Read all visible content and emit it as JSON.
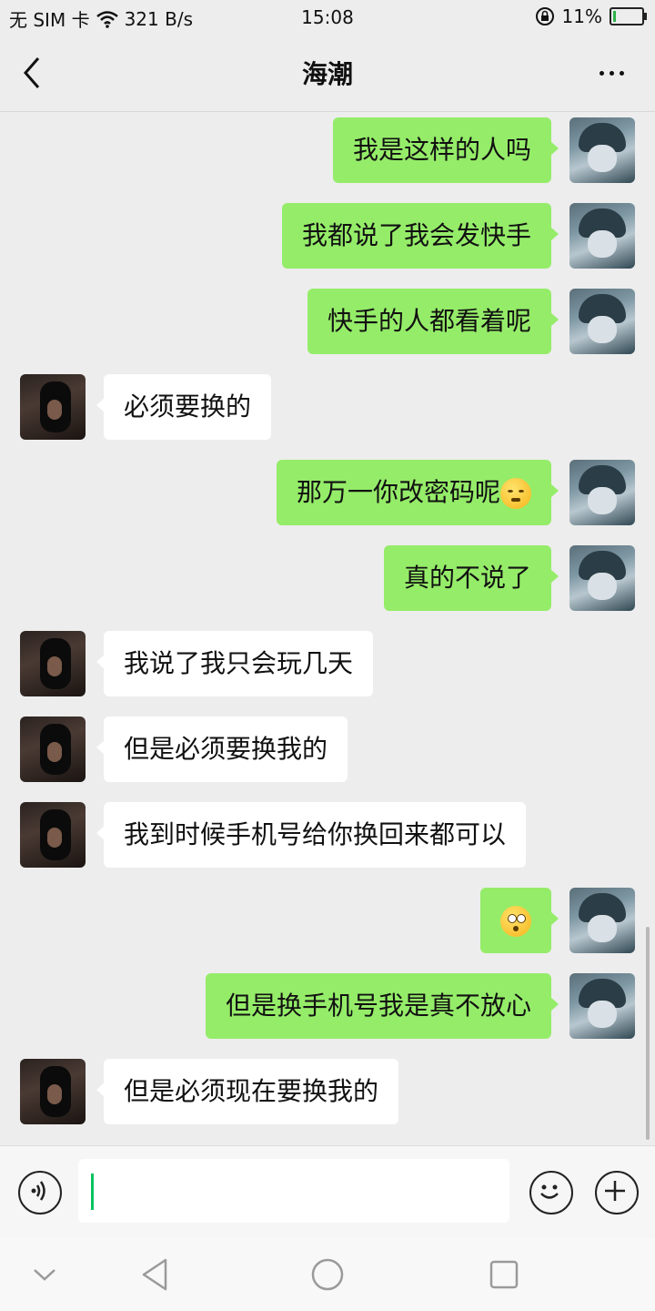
{
  "status_bar": {
    "carrier": "无 SIM 卡",
    "speed": "321 B/s",
    "time": "15:08",
    "battery_percent": "11%",
    "battery_level": 0.11,
    "icons": [
      "wifi-icon",
      "rotation-lock-icon",
      "battery-icon"
    ]
  },
  "header": {
    "title": "海潮",
    "back_icon": "back-arrow-icon",
    "more_icon": "more-dots-icon"
  },
  "messages": [
    {
      "side": "me",
      "text": "我是这样的人吗"
    },
    {
      "side": "me",
      "text": "我都说了我会发快手"
    },
    {
      "side": "me",
      "text": "快手的人都看着呢"
    },
    {
      "side": "them",
      "text": "必须要换的"
    },
    {
      "side": "me",
      "text": "那万一你改密码呢",
      "emoji": "squint-face-emoji"
    },
    {
      "side": "me",
      "text": "真的不说了"
    },
    {
      "side": "them",
      "text": "我说了我只会玩几天"
    },
    {
      "side": "them",
      "text": "但是必须要换我的"
    },
    {
      "side": "them",
      "text": "我到时候手机号给你换回来都可以"
    },
    {
      "side": "me",
      "text": "",
      "emoji": "shocked-face-emoji"
    },
    {
      "side": "me",
      "text": "但是换手机号我是真不放心"
    },
    {
      "side": "them",
      "text": "但是必须现在要换我的"
    }
  ],
  "input_bar": {
    "value": "",
    "voice_icon": "voice-icon",
    "emoji_icon": "emoji-icon",
    "plus_icon": "plus-icon"
  },
  "system_nav": {
    "icons": [
      "collapse-icon",
      "back-triangle-icon",
      "home-circle-icon",
      "recents-square-icon"
    ]
  },
  "colors": {
    "my_bubble": "#95ec69",
    "their_bubble": "#ffffff",
    "background": "#ededed",
    "caret": "#07c160"
  }
}
